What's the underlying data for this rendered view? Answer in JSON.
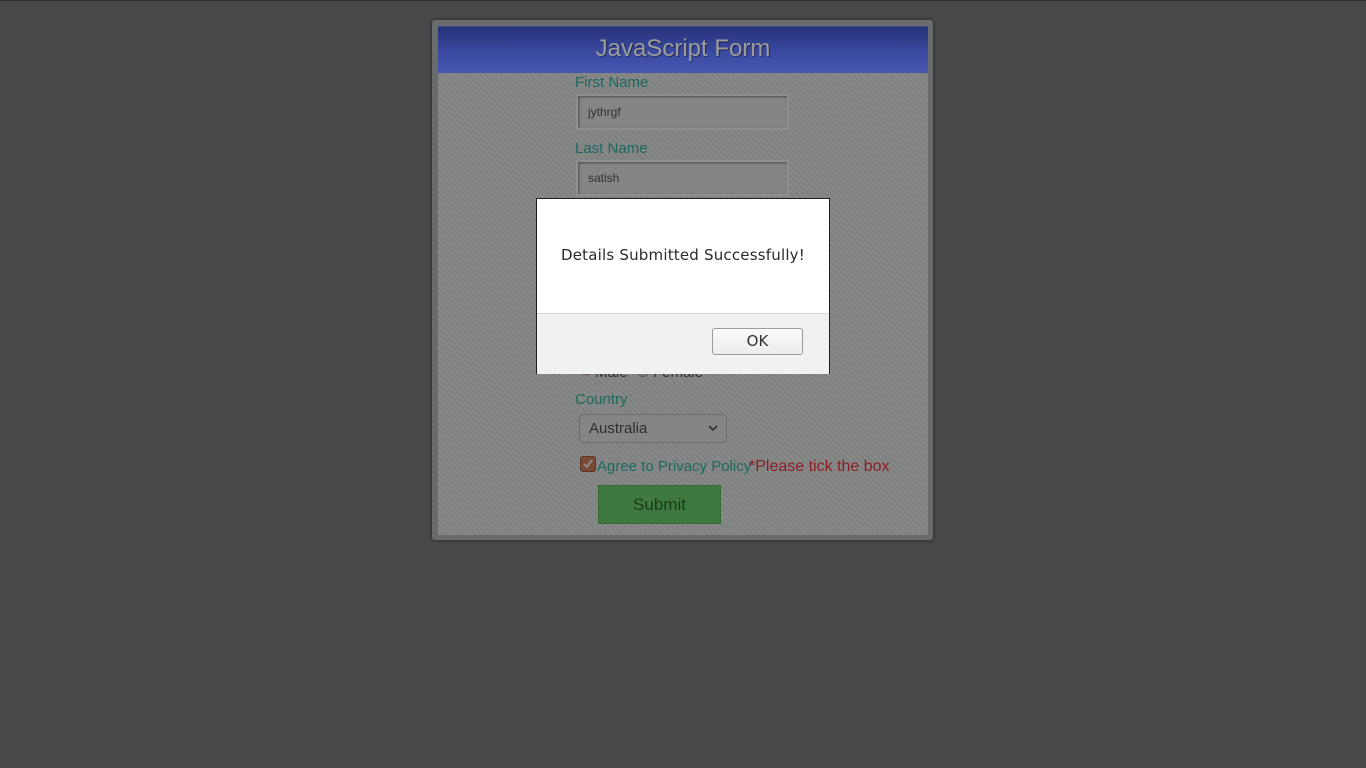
{
  "form": {
    "title": "JavaScript Form",
    "first_name": {
      "label": "First Name",
      "value": "jythrgf"
    },
    "last_name": {
      "label": "Last Name",
      "value": "satish"
    },
    "gender": {
      "options": [
        {
          "label": "Male",
          "checked": true
        },
        {
          "label": "Female",
          "checked": false
        }
      ]
    },
    "country": {
      "label": "Country",
      "selected": "Australia"
    },
    "privacy": {
      "label": "Agree to Privacy Policy",
      "checked": true,
      "error": "*Please tick the box"
    },
    "submit_label": "Submit"
  },
  "dialog": {
    "message": "Details Submitted Successfully!",
    "ok_label": "OK"
  },
  "colors": {
    "page_background": "#47484a",
    "header_blue": "#3b4aa1",
    "label_teal": "#1c6a5e",
    "error_red": "#8a1f22",
    "submit_green": "#3e7a3f"
  },
  "icons": {
    "select": "chevron-down-icon",
    "checkbox": "checkmark-icon"
  }
}
